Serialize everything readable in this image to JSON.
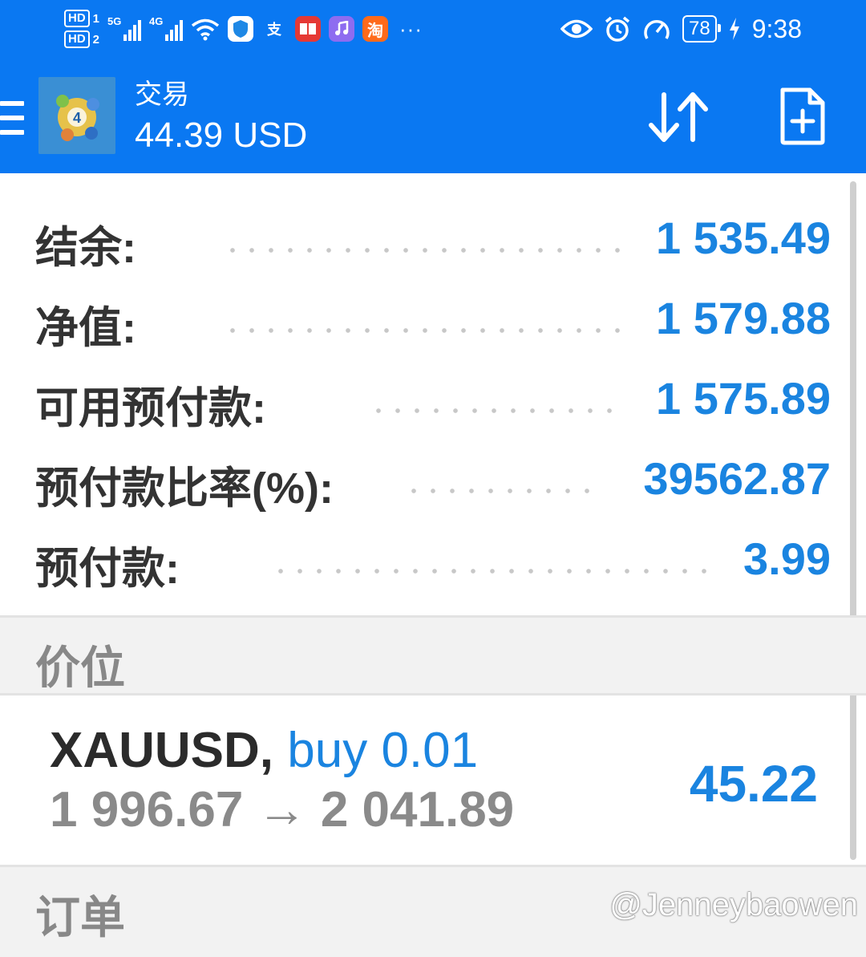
{
  "status_bar": {
    "sim1": "HD",
    "sim1_num": "1",
    "sim2": "HD",
    "sim2_num": "2",
    "net1": "5G",
    "net2": "4G",
    "battery": "78",
    "time": "9:38",
    "more": "···",
    "icons": [
      "wifi-icon",
      "shield-app-icon",
      "alipay-icon",
      "book-app-icon",
      "music-app-icon",
      "taobao-icon",
      "eye-icon",
      "alarm-icon",
      "speedometer-icon",
      "charging-icon"
    ]
  },
  "header": {
    "title": "交易",
    "balance": "44.39 USD",
    "accent_color": "#0a78f2"
  },
  "account": {
    "rows": [
      {
        "label": "结余:",
        "value": "1 535.49"
      },
      {
        "label": "净值:",
        "value": "1 579.88"
      },
      {
        "label": "可用预付款:",
        "value": "1 575.89"
      },
      {
        "label": "预付款比率(%):",
        "value": "39562.87"
      },
      {
        "label": "预付款:",
        "value": "3.99"
      }
    ]
  },
  "sections": {
    "positions": "价位",
    "orders": "订单"
  },
  "position": {
    "symbol": "XAUUSD,",
    "direction": "buy 0.01",
    "open_price": "1 996.67",
    "arrow": "→",
    "current_price": "2 041.89",
    "profit": "45.22"
  },
  "watermark": "@Jenneybaowen",
  "colors": {
    "value_blue": "#1a84e0",
    "label_dark": "#333333",
    "muted_gray": "#888888"
  }
}
